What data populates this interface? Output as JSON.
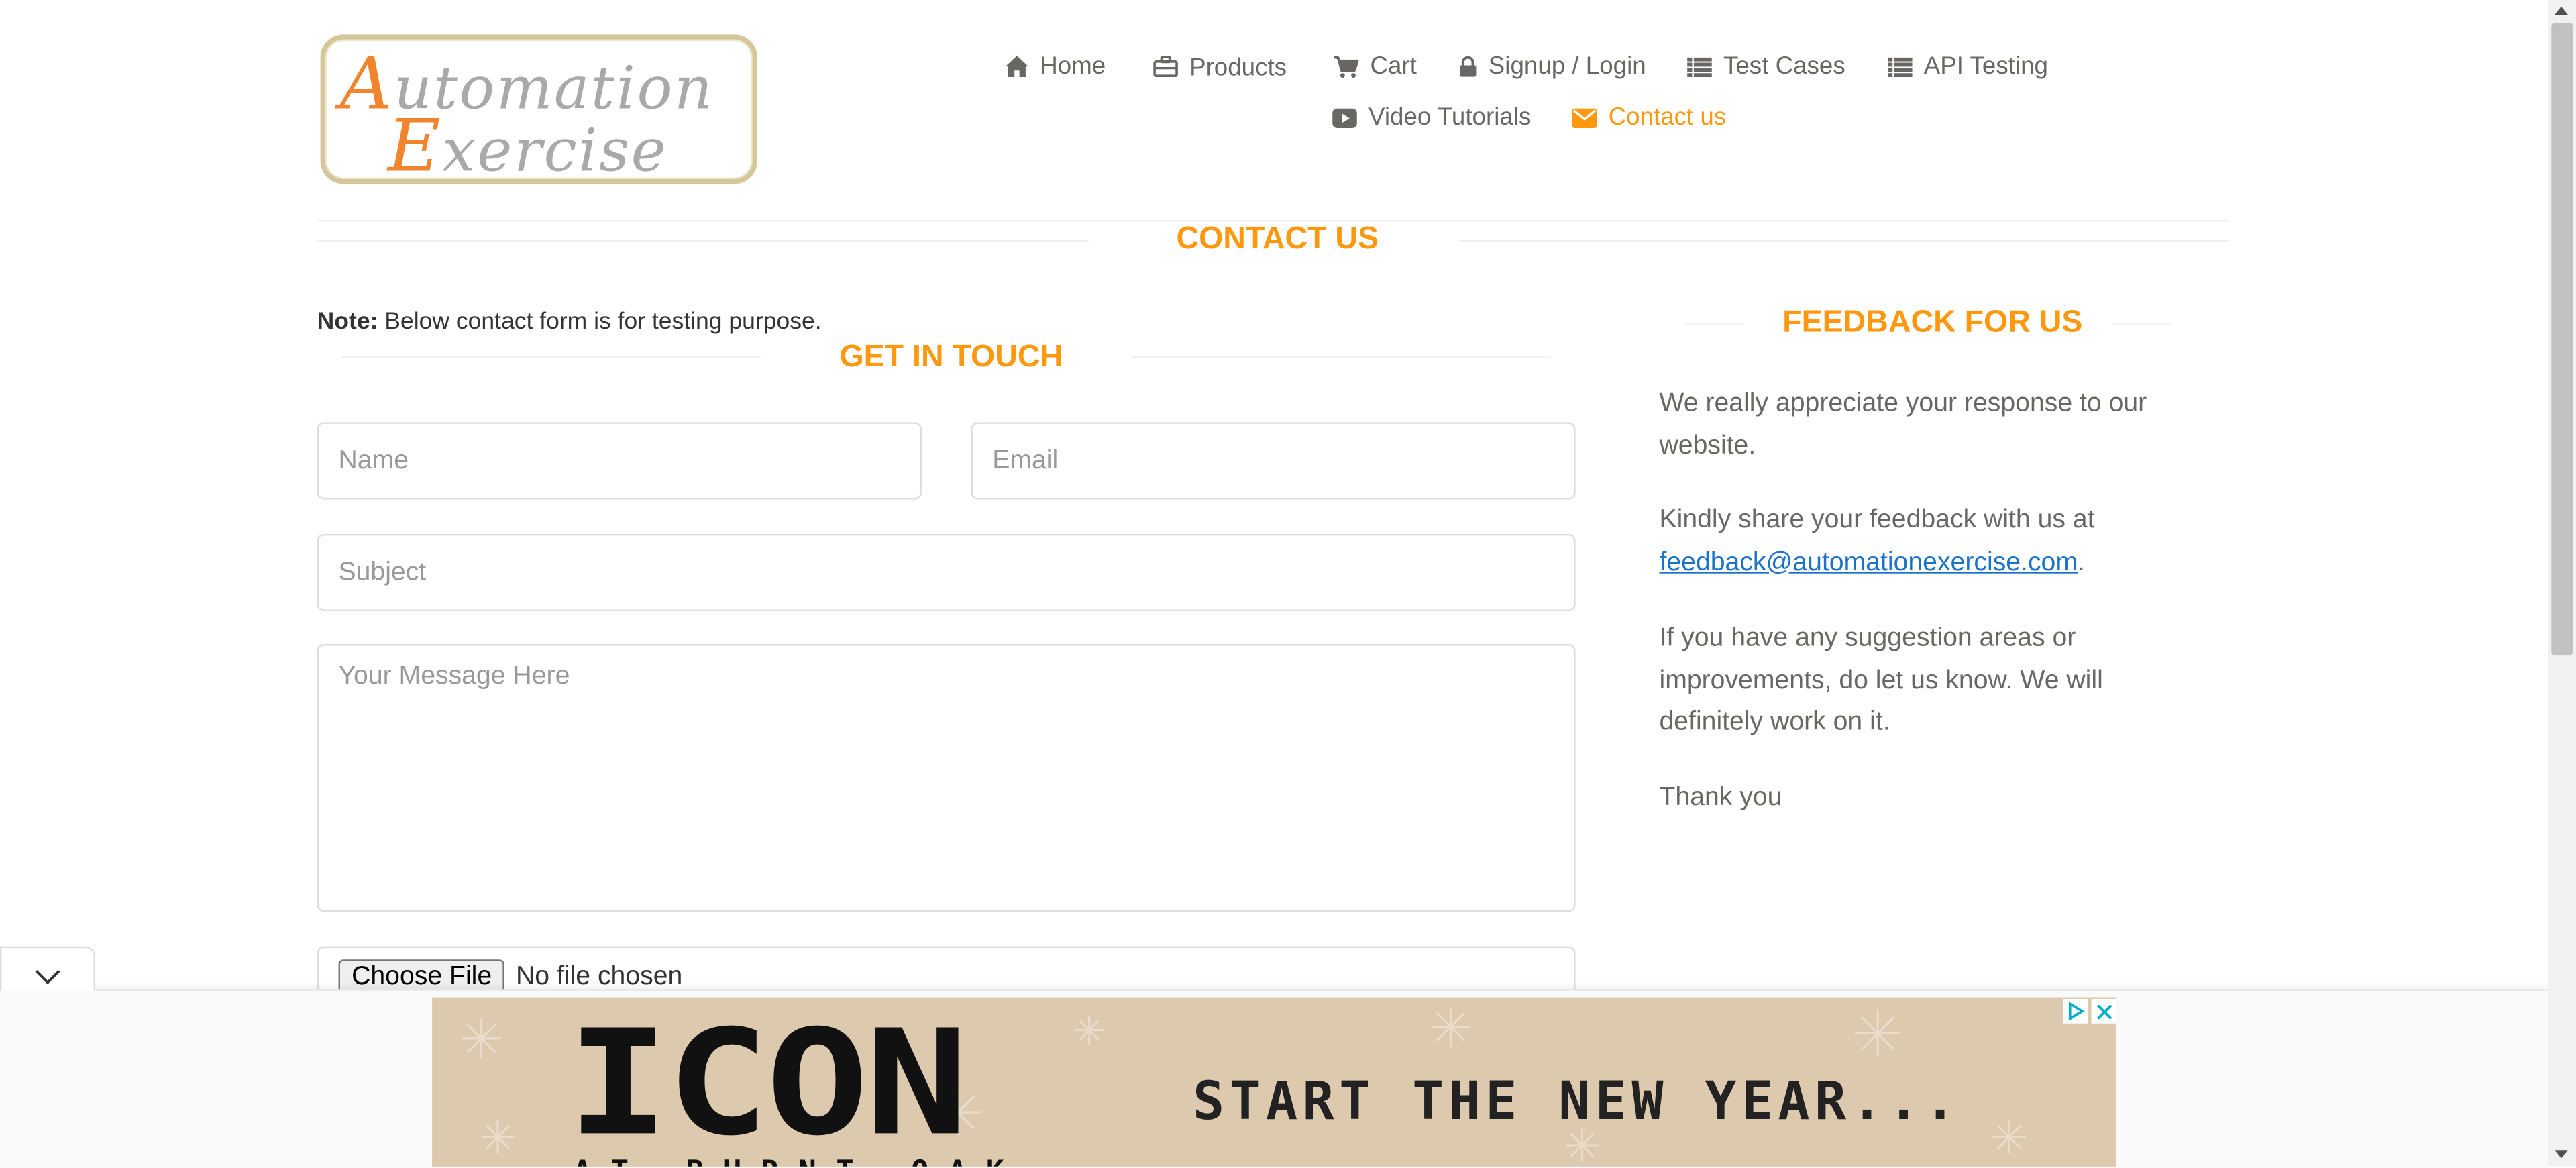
{
  "logo": {
    "line1_cap": "A",
    "line1_rest": "utomation",
    "line2_cap": "E",
    "line2_rest": "xercise"
  },
  "nav": {
    "home": "Home",
    "products": "Products",
    "cart": "Cart",
    "signup": "Signup / Login",
    "test_cases": "Test Cases",
    "api_testing": "API Testing",
    "video_tutorials": "Video Tutorials",
    "contact_us": "Contact us"
  },
  "page_title": "CONTACT US",
  "note": {
    "bold": "Note:",
    "text": " Below contact form is for testing purpose."
  },
  "form": {
    "heading": "GET IN TOUCH",
    "name_placeholder": "Name",
    "email_placeholder": "Email",
    "subject_placeholder": "Subject",
    "message_placeholder": "Your Message Here",
    "file_button": "Choose File",
    "file_status": "No file chosen"
  },
  "feedback": {
    "heading": "FEEDBACK FOR US",
    "p1": "We really appreciate your response to our website.",
    "p2_prefix": "Kindly share your feedback with us at ",
    "email": "feedback@automationexercise.com",
    "p2_suffix": ".",
    "p3": "If you have any suggestion areas or improvements, do let us know. We will definitely work on it.",
    "p4": "Thank you"
  },
  "ad": {
    "logo_text": "ICON",
    "logo_subtext": "AT BURNT OAK",
    "slogan": "START THE NEW YEAR..."
  },
  "colors": {
    "accent": "#fe980f",
    "link": "#1a73c8",
    "text": "#696763"
  }
}
